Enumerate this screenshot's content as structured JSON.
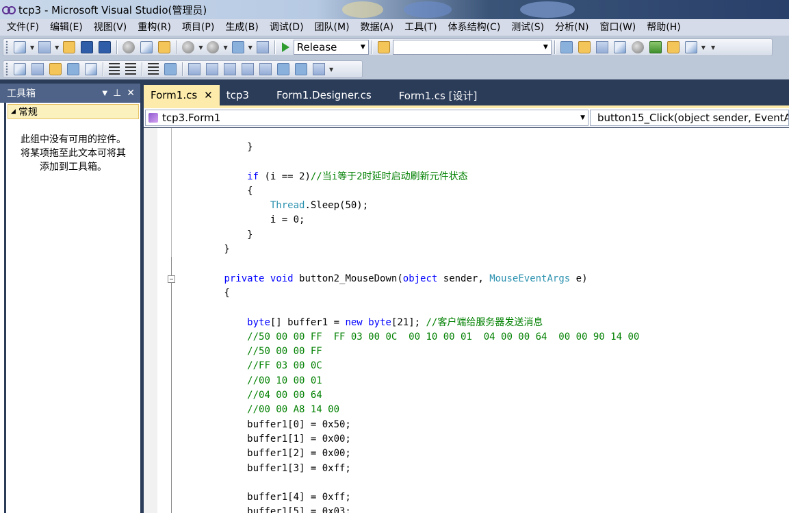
{
  "window": {
    "title": "tcp3 - Microsoft Visual Studio(管理员)"
  },
  "menu": [
    "文件(F)",
    "编辑(E)",
    "视图(V)",
    "重构(R)",
    "项目(P)",
    "生成(B)",
    "调试(D)",
    "团队(M)",
    "数据(A)",
    "工具(T)",
    "体系结构(C)",
    "测试(S)",
    "分析(N)",
    "窗口(W)",
    "帮助(H)"
  ],
  "toolbar": {
    "config_value": "Release",
    "search_value": ""
  },
  "toolbox": {
    "title": "工具箱",
    "group": "常规",
    "empty_line1": "此组中没有可用的控件。",
    "empty_line2": "将某项拖至此文本可将其",
    "empty_line3": "添加到工具箱。"
  },
  "tabs": [
    "Form1.cs",
    "tcp3",
    "Form1.Designer.cs",
    "Form1.cs [设计]"
  ],
  "nav": {
    "class_value": "tcp3.Form1",
    "member_value": "button15_Click(object sender, EventA"
  },
  "code": [
    [
      {
        "t": "            }"
      }
    ],
    [
      {
        "t": ""
      }
    ],
    [
      {
        "t": "            "
      },
      {
        "t": "if",
        "c": "kw"
      },
      {
        "t": " (i == 2)"
      },
      {
        "t": "//当i等于2时延时启动刷新元件状态",
        "c": "cm"
      }
    ],
    [
      {
        "t": "            {"
      }
    ],
    [
      {
        "t": "                "
      },
      {
        "t": "Thread",
        "c": "ty"
      },
      {
        "t": ".Sleep(50);"
      }
    ],
    [
      {
        "t": "                i = 0;"
      }
    ],
    [
      {
        "t": "            }"
      }
    ],
    [
      {
        "t": "        }"
      }
    ],
    [
      {
        "t": ""
      }
    ],
    [
      {
        "t": "        "
      },
      {
        "t": "private",
        "c": "kw"
      },
      {
        "t": " "
      },
      {
        "t": "void",
        "c": "kw"
      },
      {
        "t": " button2_MouseDown("
      },
      {
        "t": "object",
        "c": "kw"
      },
      {
        "t": " sender, "
      },
      {
        "t": "MouseEventArgs",
        "c": "ty"
      },
      {
        "t": " e)"
      }
    ],
    [
      {
        "t": "        {"
      }
    ],
    [
      {
        "t": ""
      }
    ],
    [
      {
        "t": "            "
      },
      {
        "t": "byte",
        "c": "kw"
      },
      {
        "t": "[] buffer1 = "
      },
      {
        "t": "new",
        "c": "kw"
      },
      {
        "t": " "
      },
      {
        "t": "byte",
        "c": "kw"
      },
      {
        "t": "[21]; "
      },
      {
        "t": "//客户端给服务器发送消息",
        "c": "cm"
      }
    ],
    [
      {
        "t": "            "
      },
      {
        "t": "//50 00 00 FF  FF 03 00 0C  00 10 00 01  04 00 00 64  00 00 90 14 00",
        "c": "cm"
      }
    ],
    [
      {
        "t": "            "
      },
      {
        "t": "//50 00 00 FF",
        "c": "cm"
      }
    ],
    [
      {
        "t": "            "
      },
      {
        "t": "//FF 03 00 0C",
        "c": "cm"
      }
    ],
    [
      {
        "t": "            "
      },
      {
        "t": "//00 10 00 01",
        "c": "cm"
      }
    ],
    [
      {
        "t": "            "
      },
      {
        "t": "//04 00 00 64",
        "c": "cm"
      }
    ],
    [
      {
        "t": "            "
      },
      {
        "t": "//00 00 A8 14 00",
        "c": "cm"
      }
    ],
    [
      {
        "t": "            buffer1[0] = 0x50;"
      }
    ],
    [
      {
        "t": "            buffer1[1] = 0x00;"
      }
    ],
    [
      {
        "t": "            buffer1[2] = 0x00;"
      }
    ],
    [
      {
        "t": "            buffer1[3] = 0xff;"
      }
    ],
    [
      {
        "t": ""
      }
    ],
    [
      {
        "t": "            buffer1[4] = 0xff;"
      }
    ],
    [
      {
        "t": "            buffer1[5] = 0x03;"
      }
    ]
  ]
}
